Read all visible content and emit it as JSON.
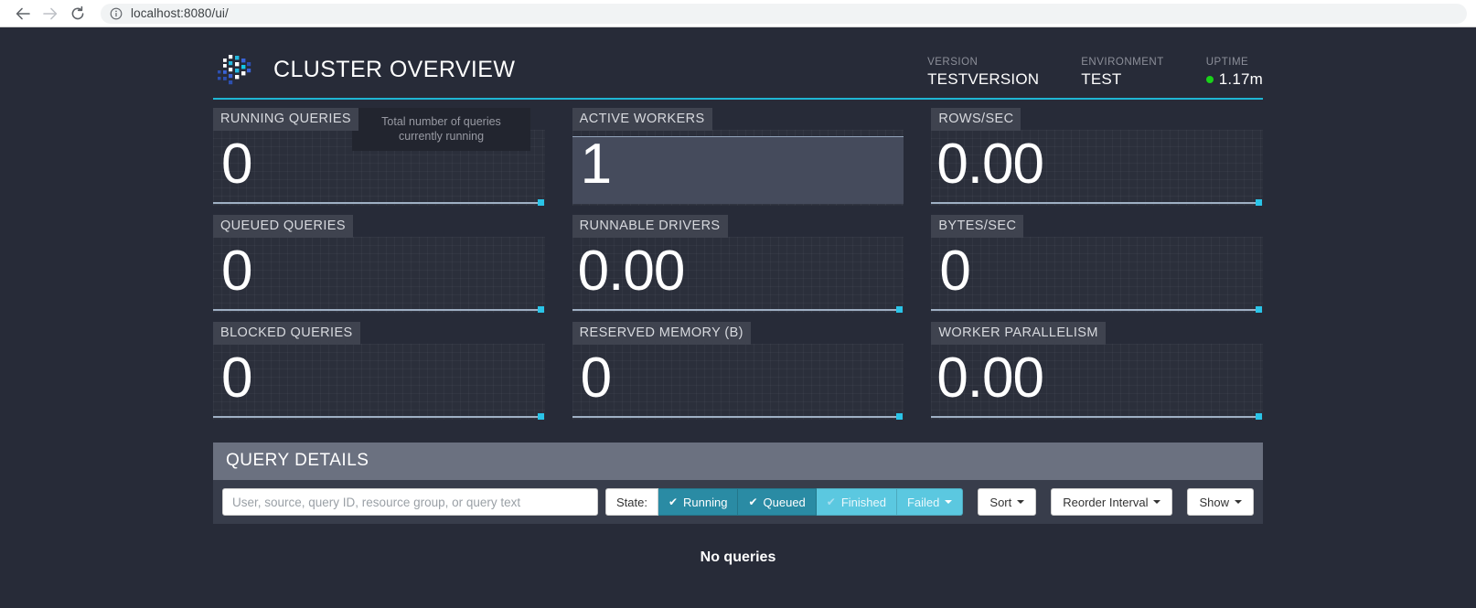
{
  "browser": {
    "back_icon": "back-arrow-icon",
    "forward_icon": "forward-arrow-icon",
    "reload_icon": "reload-icon",
    "info_icon": "info-circle-icon",
    "url": "localhost:8080/ui/"
  },
  "header": {
    "logo": "trino-dots-logo",
    "title": "CLUSTER OVERVIEW",
    "accent_color": "#1fb6d4",
    "stats": [
      {
        "label": "VERSION",
        "value": "TESTVERSION",
        "dot": false
      },
      {
        "label": "ENVIRONMENT",
        "value": "TEST",
        "dot": false
      },
      {
        "label": "UPTIME",
        "value": "1.17m",
        "dot": true,
        "dot_color": "#19d219"
      }
    ]
  },
  "tiles": [
    {
      "label": "RUNNING QUERIES",
      "value": "0",
      "tooltip": "Total number of queries currently running",
      "spark": "line"
    },
    {
      "label": "ACTIVE WORKERS",
      "value": "1",
      "tooltip": "",
      "spark": "fill"
    },
    {
      "label": "ROWS/SEC",
      "value": "0.00",
      "tooltip": "",
      "spark": "line"
    },
    {
      "label": "QUEUED QUERIES",
      "value": "0",
      "tooltip": "",
      "spark": "line"
    },
    {
      "label": "RUNNABLE DRIVERS",
      "value": "0.00",
      "tooltip": "",
      "spark": "line"
    },
    {
      "label": "BYTES/SEC",
      "value": "0",
      "tooltip": "",
      "spark": "line"
    },
    {
      "label": "BLOCKED QUERIES",
      "value": "0",
      "tooltip": "",
      "spark": "line"
    },
    {
      "label": "RESERVED MEMORY (B)",
      "value": "0",
      "tooltip": "",
      "spark": "line"
    },
    {
      "label": "WORKER PARALLELISM",
      "value": "0.00",
      "tooltip": "",
      "spark": "line"
    }
  ],
  "query_details": {
    "panel_title": "QUERY DETAILS",
    "search_placeholder": "User, source, query ID, resource group, or query text",
    "search_value": "",
    "state_label": "State:",
    "state_filters": [
      {
        "label": "Running",
        "active": true,
        "check": "✔"
      },
      {
        "label": "Queued",
        "active": true,
        "check": "✔"
      },
      {
        "label": "Finished",
        "active": false,
        "check": "✔"
      },
      {
        "label": "Failed",
        "active": false,
        "check": ""
      }
    ],
    "dropdowns": [
      {
        "label": "Sort"
      },
      {
        "label": "Reorder Interval"
      },
      {
        "label": "Show"
      }
    ],
    "empty_message": "No queries"
  }
}
